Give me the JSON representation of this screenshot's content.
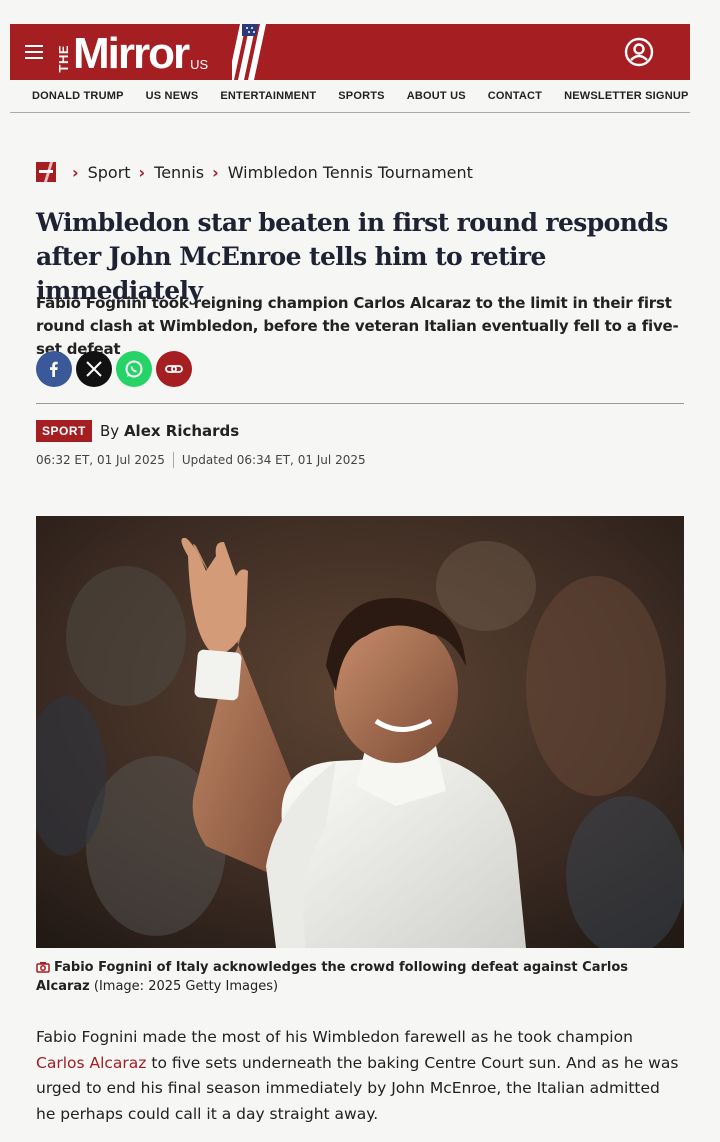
{
  "masthead": {
    "logo_the": "THE",
    "logo_mirror": "Mirror",
    "logo_us": "US",
    "brand_color": "#a41e22"
  },
  "nav": [
    "DONALD TRUMP",
    "US NEWS",
    "ENTERTAINMENT",
    "SPORTS",
    "ABOUT US",
    "CONTACT",
    "NEWSLETTER SIGNUP"
  ],
  "breadcrumb": [
    "Sport",
    "Tennis",
    "Wimbledon Tennis Tournament"
  ],
  "article": {
    "headline": "Wimbledon star beaten in first round responds after John McEnroe tells him to retire immediately",
    "standfirst": "Fabio Fognini took reigning champion Carlos Alcaraz to the limit in their first round clash at Wimbledon, before the veteran Italian eventually fell to a five-set defeat",
    "tag": "SPORT",
    "by": "By",
    "author": "Alex Richards",
    "published": "06:32 ET, 01 Jul 2025",
    "updated": "Updated 06:34 ET, 01 Jul 2025",
    "caption_bold": "Fabio Fognini of Italy acknowledges the crowd following defeat against Carlos Alcaraz",
    "caption_credit": "(Image: 2025 Getty Images)",
    "body_part1": "Fabio Fognini made the most of his Wimbledon farewell as he took champion ",
    "body_link": "Carlos Alcaraz",
    "body_part2": " to five sets underneath the baking Centre Court sun. And as he was urged to end his final season immediately by John McEnroe, the Italian admitted he perhaps could call it a day straight away."
  },
  "icons": [
    "menu-icon",
    "account-icon",
    "facebook-icon",
    "x-icon",
    "whatsapp-icon",
    "link-icon",
    "camera-icon"
  ]
}
